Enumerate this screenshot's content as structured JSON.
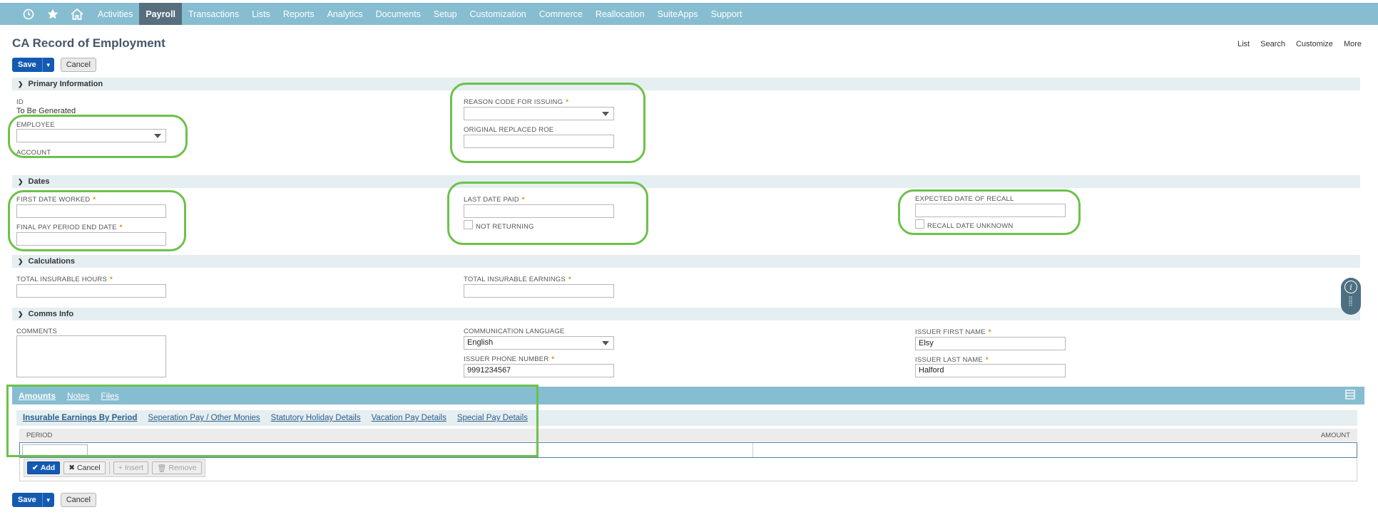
{
  "nav": {
    "items": [
      {
        "label": "Activities",
        "active": false
      },
      {
        "label": "Payroll",
        "active": true
      },
      {
        "label": "Transactions",
        "active": false
      },
      {
        "label": "Lists",
        "active": false
      },
      {
        "label": "Reports",
        "active": false
      },
      {
        "label": "Analytics",
        "active": false
      },
      {
        "label": "Documents",
        "active": false
      },
      {
        "label": "Setup",
        "active": false
      },
      {
        "label": "Customization",
        "active": false
      },
      {
        "label": "Commerce",
        "active": false
      },
      {
        "label": "Reallocation",
        "active": false
      },
      {
        "label": "SuiteApps",
        "active": false
      },
      {
        "label": "Support",
        "active": false
      }
    ],
    "icons": [
      "recent-icon",
      "star-icon",
      "home-icon"
    ]
  },
  "page": {
    "title": "CA Record of Employment",
    "links": [
      "List",
      "Search",
      "Customize",
      "More"
    ]
  },
  "buttons": {
    "save": "Save",
    "cancel": "Cancel"
  },
  "sections": {
    "primary": "Primary Information",
    "dates": "Dates",
    "calculations": "Calculations",
    "comms": "Comms Info"
  },
  "primary": {
    "id_label": "ID",
    "id_value": "To Be Generated",
    "employee_label": "EMPLOYEE",
    "employee_value": "",
    "account_label": "ACCOUNT",
    "reason_label": "REASON CODE FOR ISSUING",
    "reason_value": "",
    "orig_roe_label": "ORIGINAL REPLACED ROE",
    "orig_roe_value": ""
  },
  "dates": {
    "first_date_label": "FIRST DATE WORKED",
    "final_pay_label": "FINAL PAY PERIOD END DATE",
    "last_paid_label": "LAST DATE PAID",
    "not_returning_label": "NOT RETURNING",
    "recall_label": "EXPECTED DATE OF RECALL",
    "recall_unknown_label": "RECALL DATE UNKNOWN"
  },
  "calculations": {
    "hours_label": "TOTAL INSURABLE HOURS",
    "earnings_label": "TOTAL INSURABLE EARNINGS"
  },
  "comms": {
    "comments_label": "COMMENTS",
    "language_label": "COMMUNICATION LANGUAGE",
    "language_value": "English",
    "phone_label": "ISSUER PHONE NUMBER",
    "phone_value": "9991234567",
    "first_name_label": "ISSUER FIRST NAME",
    "first_name_value": "Elsy",
    "last_name_label": "ISSUER LAST NAME",
    "last_name_value": "Halford"
  },
  "tabs": [
    "Amounts",
    "Notes",
    "Files"
  ],
  "subtabs": [
    "Insurable Earnings By Period",
    "Seperation Pay / Other Monies",
    "Statutory Holiday Details",
    "Vacation Pay Details",
    "Special Pay Details"
  ],
  "grid": {
    "col_period": "PERIOD",
    "col_amount": "AMOUNT",
    "add": "Add",
    "cancel": "Cancel",
    "insert": "Insert",
    "remove": "Remove"
  },
  "colors": {
    "nav": "#86bdd1",
    "accent": "#125ab2",
    "highlight": "#6cc24a"
  }
}
